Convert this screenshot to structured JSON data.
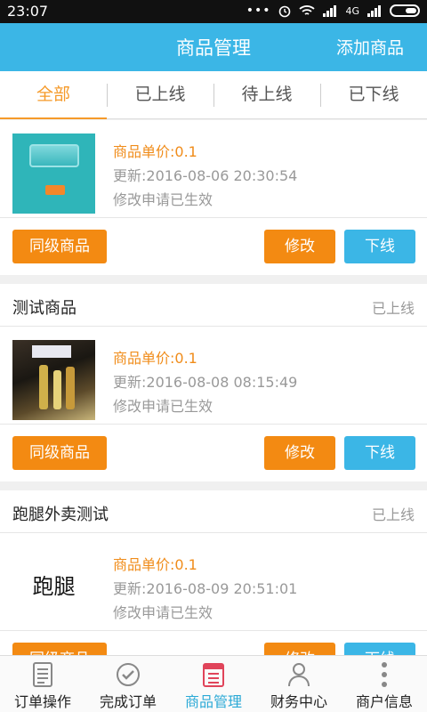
{
  "status_bar": {
    "time": "23:07",
    "network": "4G"
  },
  "header": {
    "title": "商品管理",
    "action": "添加商品"
  },
  "tabs": [
    {
      "label": "全部"
    },
    {
      "label": "已上线"
    },
    {
      "label": "待上线"
    },
    {
      "label": "已下线"
    }
  ],
  "products": [
    {
      "name": "",
      "status": "",
      "price": "商品单价:0.1",
      "updated": "更新:2016-08-06 20:30:54",
      "note": "修改申请已生效",
      "btn_same": "同级商品",
      "btn_edit": "修改",
      "btn_off": "下线"
    },
    {
      "name": "测试商品",
      "status": "已上线",
      "price": "商品单价:0.1",
      "updated": "更新:2016-08-08 08:15:49",
      "note": "修改申请已生效",
      "btn_same": "同级商品",
      "btn_edit": "修改",
      "btn_off": "下线"
    },
    {
      "name": "跑腿外卖测试",
      "status": "已上线",
      "thumb_text": "跑腿",
      "price": "商品单价:0.1",
      "updated": "更新:2016-08-09 20:51:01",
      "note": "修改申请已生效",
      "btn_same": "同级商品",
      "btn_edit": "修改",
      "btn_off": "下线"
    }
  ],
  "bottom_nav": [
    {
      "label": "订单操作",
      "icon": "order-list-icon"
    },
    {
      "label": "完成订单",
      "icon": "check-circle-icon"
    },
    {
      "label": "商品管理",
      "icon": "product-manage-icon"
    },
    {
      "label": "财务中心",
      "icon": "user-icon"
    },
    {
      "label": "商户信息",
      "icon": "more-dots-icon"
    }
  ],
  "colors": {
    "accent_blue": "#3bb6e6",
    "accent_orange": "#f38a12"
  }
}
